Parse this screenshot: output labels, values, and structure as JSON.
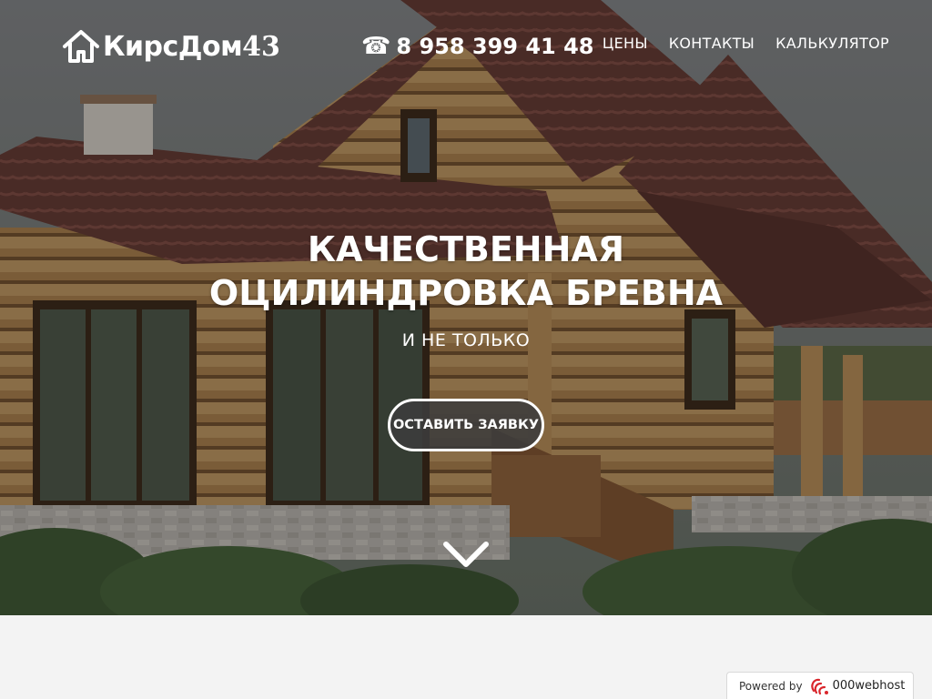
{
  "header": {
    "brand_text": "КирсДом",
    "brand_number": "43",
    "phone_icon": "telephone-icon",
    "phone": "8 958 399 41 48",
    "menu": [
      {
        "label": "ЦЕНЫ"
      },
      {
        "label": "КОНТАКТЫ"
      },
      {
        "label": "КАЛЬКУЛЯТОР"
      }
    ]
  },
  "hero": {
    "headline_line1": "КАЧЕСТВЕННАЯ",
    "headline_line2": "ОЦИЛИНДРОВКА БРЕВНА",
    "subheadline": "И НЕ ТОЛЬКО",
    "cta_label": "ОСТАВИТЬ ЗАЯВКУ",
    "scroll_icon": "chevron-down-icon"
  },
  "footer_badge": {
    "powered_label": "Powered by",
    "host_name": "000webhost"
  },
  "colors": {
    "text": "#ffffff",
    "cta_bg": "#3c3c3c",
    "below_bg": "#f3f3f3"
  }
}
